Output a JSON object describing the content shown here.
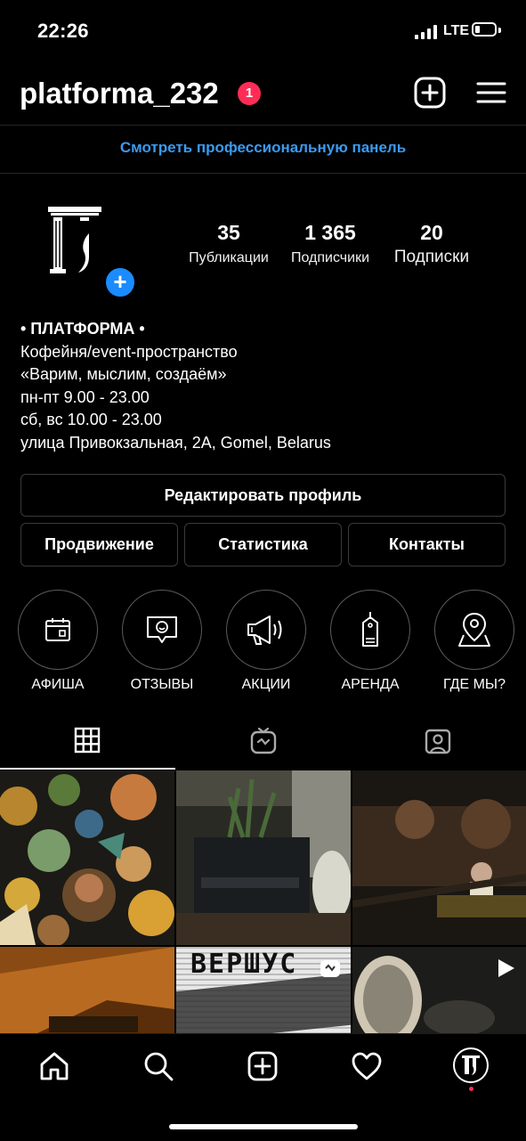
{
  "status_bar": {
    "time": "22:26",
    "network": "LTE"
  },
  "header": {
    "username": "platforma_232",
    "notification_count": "1"
  },
  "pro_panel": {
    "label": "Смотреть профессиональную панель"
  },
  "profile": {
    "stats": [
      {
        "value": "35",
        "label": "Публикации"
      },
      {
        "value": "1 365",
        "label": "Подписчики"
      },
      {
        "value": "20",
        "label": "Подписки"
      }
    ],
    "bio": {
      "name": "• ПЛАТФОРМА •",
      "lines": [
        "Кофейня/event-пространство",
        "«Варим, мыслим, создаём»",
        "пн-пт 9.00 - 23.00",
        "сб, вс 10.00 - 23.00",
        "улица Привокзальная, 2А, Gomel, Belarus"
      ]
    }
  },
  "buttons": {
    "edit_profile": "Редактировать профиль",
    "promotion": "Продвижение",
    "statistics": "Статистика",
    "contacts": "Контакты"
  },
  "highlights": [
    {
      "label": "АФИША",
      "icon": "calendar-icon"
    },
    {
      "label": "ОТЗЫВЫ",
      "icon": "review-chat-icon"
    },
    {
      "label": "АКЦИИ",
      "icon": "megaphone-icon"
    },
    {
      "label": "АРЕНДА",
      "icon": "price-tag-icon"
    },
    {
      "label": "ГДЕ МЫ?",
      "icon": "map-pin-icon"
    }
  ],
  "tabs": [
    {
      "name": "grid-icon",
      "active": true
    },
    {
      "name": "igtv-icon",
      "active": false
    },
    {
      "name": "tagged-icon",
      "active": false
    }
  ],
  "posts": [
    {
      "text": ""
    },
    {
      "text": ""
    },
    {
      "text": ""
    },
    {
      "text": ""
    },
    {
      "text": "ВЕРШУС"
    },
    {
      "text": ""
    }
  ],
  "bottom_nav": [
    "home-icon",
    "search-icon",
    "new-post-icon",
    "activity-heart-icon",
    "profile-avatar-icon"
  ],
  "colors": {
    "accent_blue": "#3a9bf0",
    "badge_red": "#ff2d55",
    "plus_blue": "#1a8cff",
    "border": "#3a3a3a"
  }
}
